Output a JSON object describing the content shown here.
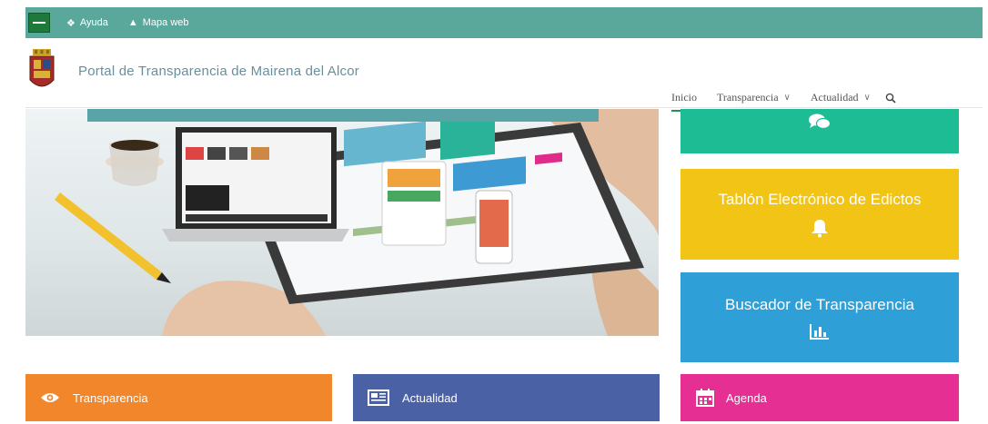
{
  "topbar": {
    "help": "Ayuda",
    "sitemap": "Mapa web"
  },
  "header": {
    "title": "Portal de Transparencia de Mairena del Alcor"
  },
  "nav": {
    "items": [
      {
        "label": "Inicio"
      },
      {
        "label": "Transparencia"
      },
      {
        "label": "Actualidad"
      }
    ]
  },
  "tiles": {
    "edictos": "Tablón Electrónico de Edictos",
    "buscador": "Buscador de Transparencia",
    "agenda": "Agenda"
  },
  "cards": {
    "transparencia": "Transparencia",
    "actualidad": "Actualidad"
  },
  "colors": {
    "topbar": "#5aa89c",
    "green": "#1dbc94",
    "yellow": "#f1c416",
    "blue": "#2f9fd8",
    "pink": "#e52f92",
    "orange": "#f1862a",
    "navy": "#4a61a6"
  }
}
